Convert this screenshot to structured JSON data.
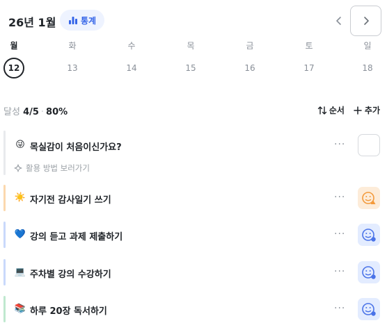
{
  "header": {
    "month_title": "26년 1월",
    "stats_label": "통계"
  },
  "week": [
    {
      "label": "월",
      "date": "12",
      "selected": true
    },
    {
      "label": "화",
      "date": "13"
    },
    {
      "label": "수",
      "date": "14"
    },
    {
      "label": "목",
      "date": "15"
    },
    {
      "label": "금",
      "date": "16"
    },
    {
      "label": "토",
      "date": "17"
    },
    {
      "label": "일",
      "date": "18"
    }
  ],
  "summary": {
    "label": "달성",
    "count": "4/5",
    "percent": "80%"
  },
  "toolbar": {
    "order_label": "순서",
    "add_label": "추가"
  },
  "items": [
    {
      "emoji": "😜",
      "title": "목실감이 처음이신가요?",
      "hint": "활용 방법 보러가기",
      "bar_color": "#e8eaed",
      "check": "empty"
    },
    {
      "emoji": "☀️",
      "title": "자기전 감사일기 쓰기",
      "bar_color": "#fbd8ae",
      "check": "orange"
    },
    {
      "emoji": "💙",
      "title": "강의 듣고 과제 제출하기",
      "bar_color": "#c9d9fb",
      "check": "blue"
    },
    {
      "emoji": "💻",
      "title": "주차별 강의 수강하기",
      "bar_color": "#c9d9fb",
      "check": "blue"
    },
    {
      "emoji": "📚",
      "title": "하루 20장 독서하기",
      "bar_color": "#bfe8cf",
      "check": "blue"
    }
  ],
  "colors": {
    "accent": "#3565e8",
    "orange": "#f39a3c",
    "blue": "#4a73e8"
  }
}
